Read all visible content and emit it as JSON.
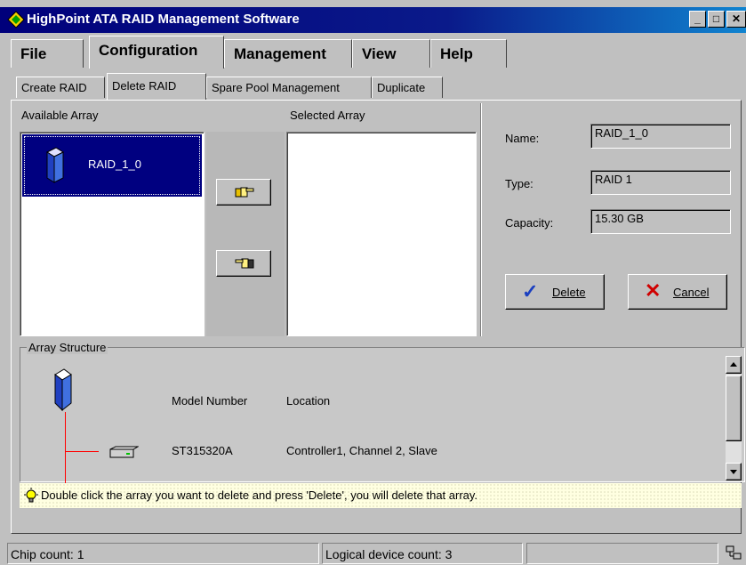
{
  "window": {
    "title": "HighPoint ATA RAID Management Software",
    "minimize": "_",
    "maximize": "□",
    "close": "✕"
  },
  "menu": {
    "items": [
      {
        "label": "File"
      },
      {
        "label": "Configuration"
      },
      {
        "label": "Management"
      },
      {
        "label": "View"
      },
      {
        "label": "Help"
      }
    ]
  },
  "subtabs": [
    {
      "label": "Create RAID"
    },
    {
      "label": "Delete RAID"
    },
    {
      "label": "Spare Pool Management"
    },
    {
      "label": "Duplicate"
    }
  ],
  "available": {
    "header": "Available Array",
    "items": [
      {
        "label": "RAID_1_0",
        "selected": true
      }
    ]
  },
  "selected": {
    "header": "Selected Array",
    "items": []
  },
  "details": {
    "name_label": "Name:",
    "name_value": "RAID_1_0",
    "type_label": "Type:",
    "type_value": "RAID 1",
    "capacity_label": "Capacity:",
    "capacity_value": "15.30 GB"
  },
  "buttons": {
    "move_right_icon": "hand-pointing-right-icon",
    "move_left_icon": "hand-pointing-left-icon",
    "delete": "Delete",
    "cancel": "Cancel"
  },
  "structure": {
    "title": "Array Structure",
    "col_model": "Model Number",
    "col_location": "Location",
    "disks": [
      {
        "model": "ST315320A",
        "location": "Controller1, Channel 2, Slave"
      }
    ]
  },
  "hint": "Double click the array you want to delete and press 'Delete', you will delete that array.",
  "status": {
    "chip_count": "Chip count: 1",
    "logical_count": "Logical device count: 3"
  },
  "colors": {
    "titlebar": "#00007b",
    "selection": "#000080",
    "hint_bg": "#ffffe1",
    "tree_line": "#ff0000"
  }
}
